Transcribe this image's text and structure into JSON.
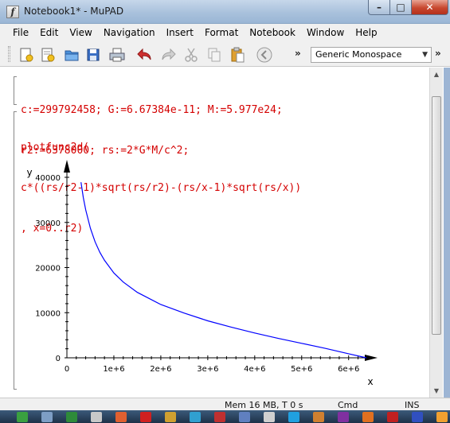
{
  "window": {
    "title": "Notebook1* - MuPAD",
    "app_icon": "f",
    "minimize_glyph": "–",
    "maximize_glyph": "□",
    "close_glyph": "✕"
  },
  "menu": [
    "File",
    "Edit",
    "View",
    "Navigation",
    "Insert",
    "Format",
    "Notebook",
    "Window",
    "Help"
  ],
  "toolbar": {
    "buttons": [
      "new-notebook-icon",
      "new-text-icon",
      "open-folder-icon",
      "save-icon",
      "print-icon",
      "undo-icon",
      "redo-icon",
      "cut-icon",
      "copy-icon",
      "paste-icon",
      "stop-icon"
    ],
    "overflow_glyph": "»",
    "font_select_value": "Generic Monospace",
    "font_select_arrow": "▼",
    "overflow2_glyph": "»"
  },
  "notebook": {
    "input1_lines": [
      "c:=299792458; G:=6.67384e-11; M:=5.977e24;",
      "r2:=6378000; rs:=2*G*M/c^2;"
    ],
    "input2_lines": [
      "plotfunc2d(",
      "c*((rs/r2-1)*sqrt(rs/r2)-(rs/x-1)*sqrt(rs/x))",
      ", x=0..r2)"
    ]
  },
  "chart_data": {
    "type": "line",
    "title": "",
    "xlabel": "x",
    "ylabel": "y",
    "xlim": [
      0,
      6378000
    ],
    "ylim": [
      0,
      40000
    ],
    "x_ticks": [
      "0",
      "1e+6",
      "2e+6",
      "3e+6",
      "4e+6",
      "5e+6",
      "6e+6"
    ],
    "y_ticks": [
      "0",
      "10000",
      "20000",
      "30000",
      "40000"
    ],
    "series_color": "#0000ff",
    "series": [
      {
        "x": [
          300000,
          350000,
          400000,
          500000,
          600000,
          700000,
          800000,
          1000000,
          1200000,
          1500000,
          2000000,
          2500000,
          3000000,
          3500000,
          4000000,
          4500000,
          5000000,
          5500000,
          6000000,
          6378000
        ],
        "values": [
          38900,
          35500,
          32800,
          28700,
          25700,
          23400,
          21600,
          18800,
          16800,
          14500,
          11800,
          9900,
          8200,
          6800,
          5500,
          4300,
          3200,
          2100,
          900,
          0
        ]
      }
    ],
    "grid": false
  },
  "scrollbar": {
    "up_glyph": "▲",
    "down_glyph": "▼"
  },
  "status": {
    "memory": "Mem 16 MB, T 0 s",
    "mode": "Cmd",
    "ins": "INS"
  },
  "taskbar_colors": [
    "#3aa040",
    "#7d9ec5",
    "#2e8b3a",
    "#c8c8c8",
    "#e06030",
    "#d02020",
    "#cfa030",
    "#30a0d0",
    "#c03030",
    "#6080c0",
    "#d0d0d0",
    "#20a0e0",
    "#d08030",
    "#8030a0",
    "#e07020",
    "#c02020",
    "#3050c0",
    "#f0a030"
  ]
}
